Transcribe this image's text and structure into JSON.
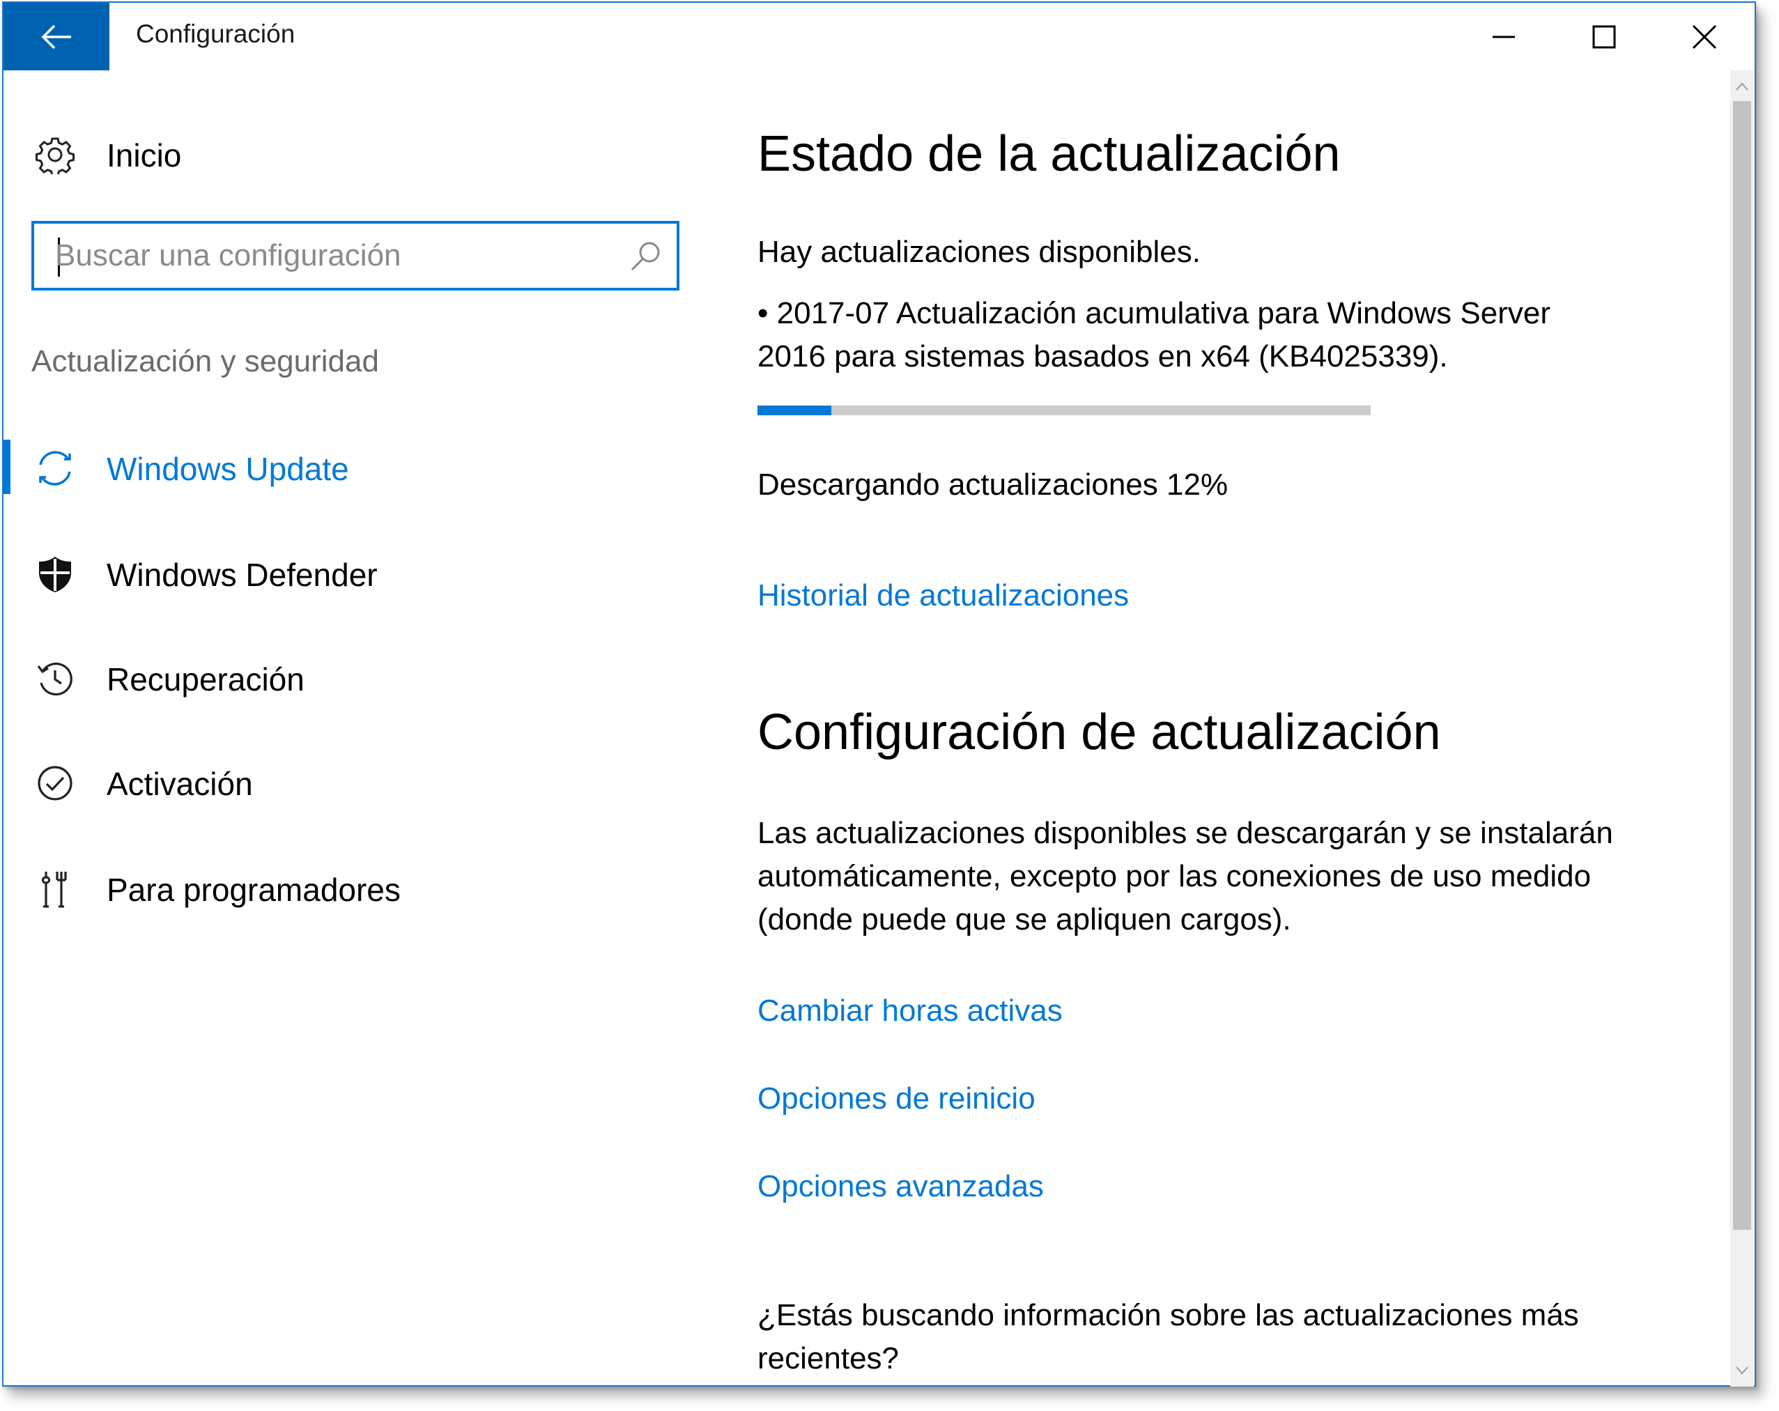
{
  "window": {
    "title": "Configuración",
    "accent_color": "#0078d7",
    "back_button_color": "#0063b1"
  },
  "caption_buttons": {
    "minimize_icon": "minimize-icon",
    "maximize_icon": "maximize-icon",
    "close_icon": "close-icon"
  },
  "sidebar": {
    "home": {
      "label": "Inicio",
      "icon": "gear-icon"
    },
    "search": {
      "placeholder": "Buscar una configuración",
      "value": "",
      "icon": "search-icon"
    },
    "section_label": "Actualización y seguridad",
    "items": [
      {
        "label": "Windows Update",
        "icon": "sync-icon",
        "active": true
      },
      {
        "label": "Windows Defender",
        "icon": "shield-icon",
        "active": false
      },
      {
        "label": "Recuperación",
        "icon": "history-icon",
        "active": false
      },
      {
        "label": "Activación",
        "icon": "check-circle-icon",
        "active": false
      },
      {
        "label": "Para programadores",
        "icon": "developer-tools-icon",
        "active": false
      }
    ]
  },
  "main": {
    "status_heading": "Estado de la actualización",
    "status_text": "Hay actualizaciones disponibles.",
    "update_line1": "• 2017-07 Actualización acumulativa para Windows Server",
    "update_line2": "2016 para sistemas basados en x64 (KB4025339).",
    "progress_percent": 12,
    "download_status": "Descargando actualizaciones 12%",
    "history_link": "Historial de actualizaciones",
    "settings_heading": "Configuración de actualización",
    "settings_line1": "Las actualizaciones disponibles se descargarán y se instalarán",
    "settings_line2": "automáticamente, excepto por las conexiones de uso medido",
    "settings_line3": "(donde puede que se apliquen cargos).",
    "links": [
      "Cambiar horas activas",
      "Opciones de reinicio",
      "Opciones avanzadas"
    ],
    "info_line1": "¿Estás buscando información sobre las actualizaciones más",
    "info_line2": "recientes?"
  }
}
